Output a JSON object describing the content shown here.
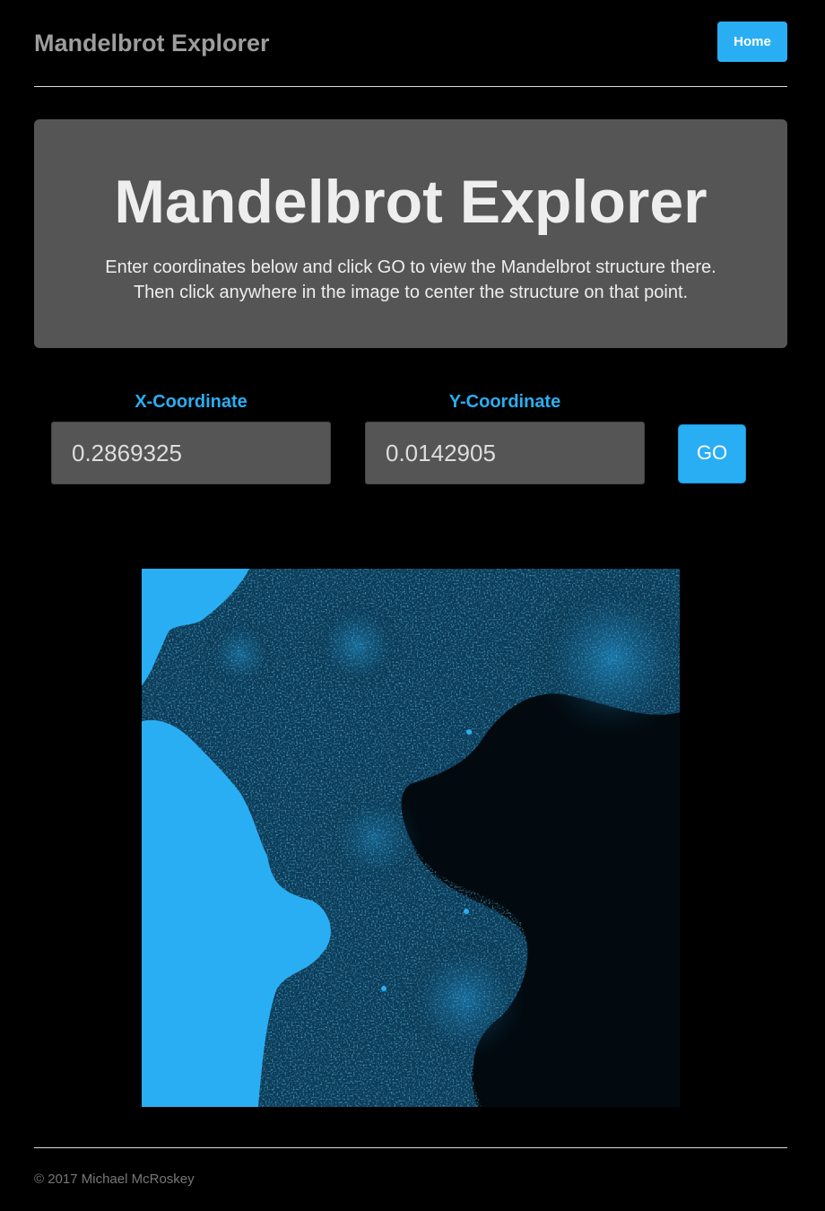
{
  "header": {
    "brand": "Mandelbrot Explorer",
    "home_label": "Home"
  },
  "jumbotron": {
    "title": "Mandelbrot Explorer",
    "line1": "Enter coordinates below and click GO to view the Mandelbrot structure there.",
    "line2": "Then click anywhere in the image to center the structure on that point."
  },
  "form": {
    "x_label": "X-Coordinate",
    "x_value": "0.2869325",
    "y_label": "Y-Coordinate",
    "y_value": "0.0142905",
    "go_label": "GO"
  },
  "footer": {
    "copyright": "© 2017 Michael McRoskey"
  },
  "colors": {
    "accent": "#2aaef3",
    "panel": "#555555",
    "background": "#000000",
    "fractal_dark": "#020a10"
  }
}
